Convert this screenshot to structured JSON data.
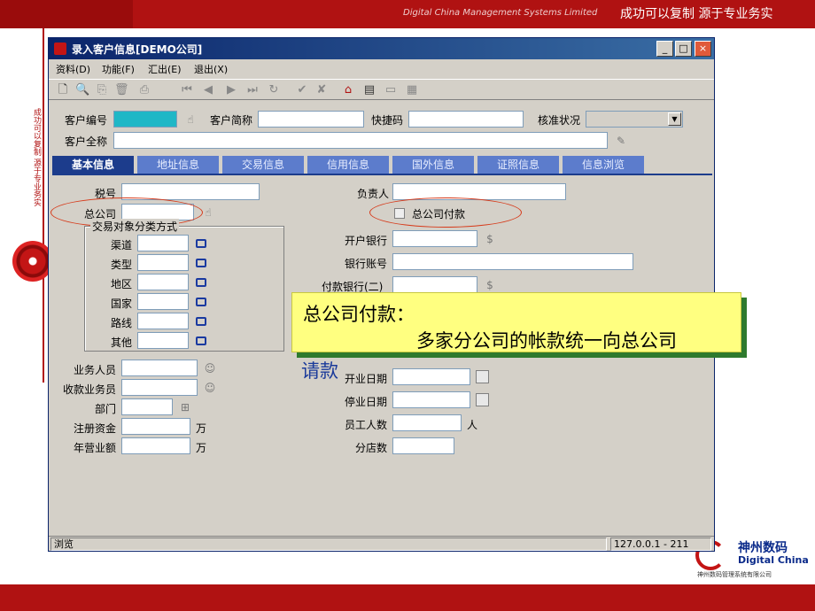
{
  "slide": {
    "slogan_en": "Digital China Management Systems Limited",
    "slogan_cn": "成功可以复制   源于专业务实",
    "side_text": "成功可以复制 源于专业务实",
    "logo_cn": "神州数码",
    "logo_en": "Digital China",
    "logo_small": "神州数码管理系统有限公司",
    "accent": "#b01212"
  },
  "window": {
    "title": "录入客户信息[DEMO公司]",
    "buttons": {
      "minimize": "_",
      "maximize": "□",
      "close": "×"
    }
  },
  "menu": [
    {
      "label": "资料(D)"
    },
    {
      "label": "功能(F)"
    },
    {
      "label": "汇出(E)"
    },
    {
      "label": "退出(X)"
    }
  ],
  "toolbar": {
    "icons": [
      "new-icon",
      "preview-icon",
      "copy-icon",
      "delete-icon",
      "print-icon",
      "first-icon",
      "prev-icon",
      "next-icon",
      "last-icon",
      "refresh-icon",
      "confirm-icon",
      "cancel-icon",
      "home-icon",
      "attach-icon",
      "card-icon",
      "report-icon"
    ]
  },
  "header_form": {
    "customer_code_label": "客户编号",
    "customer_code_value": "",
    "short_name_label": "客户简称",
    "short_name_value": "",
    "quick_code_label": "快捷码",
    "quick_code_value": "",
    "approval_label": "核准状况",
    "approval_value": "",
    "full_name_label": "客户全称",
    "full_name_value": ""
  },
  "tabs": [
    {
      "label": "基本信息",
      "active": true
    },
    {
      "label": "地址信息",
      "active": false
    },
    {
      "label": "交易信息",
      "active": false
    },
    {
      "label": "信用信息",
      "active": false
    },
    {
      "label": "国外信息",
      "active": false
    },
    {
      "label": "证照信息",
      "active": false
    },
    {
      "label": "信息浏览",
      "active": false
    }
  ],
  "basic": {
    "tax_no_label": "税号",
    "head_company_label": "总公司",
    "trade_group_title": "交易对象分类方式",
    "trade_fields": [
      "渠道",
      "类型",
      "地区",
      "国家",
      "路线",
      "其他"
    ],
    "salesperson_label": "业务人员",
    "collector_label": "收款业务员",
    "department_label": "部门",
    "reg_capital_label": "注册资金",
    "reg_capital_unit": "万",
    "annual_sales_label": "年营业额",
    "annual_sales_unit": "万",
    "manager_label": "负责人",
    "hq_payment_label": "总公司付款",
    "bank_label": "开户银行",
    "bank_account_label": "银行账号",
    "pay_bank_label": "付款银行(二)",
    "open_date_label": "开业日期",
    "close_date_label": "停业日期",
    "employees_label": "员工人数",
    "employees_unit": "人",
    "branches_label": "分店数"
  },
  "callout": {
    "line1": "总公司付款：",
    "line2": "多家分公司的帐款统一向总公司",
    "overflow": "请款"
  },
  "status": {
    "mode": "浏览",
    "server": "127.0.0.1 - 211"
  }
}
